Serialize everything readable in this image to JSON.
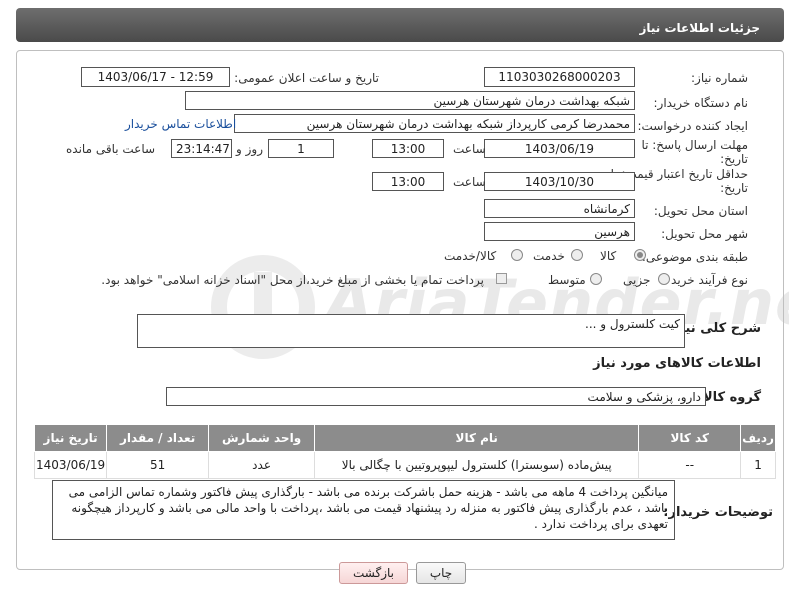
{
  "header": {
    "title": "جزئیات اطلاعات نیاز"
  },
  "form": {
    "need_number": {
      "label": "شماره نیاز:",
      "value": "1103030268000203"
    },
    "announce": {
      "label": "تاریخ و ساعت اعلان عمومی:",
      "value": "1403/06/17 - 12:59"
    },
    "buyer_org": {
      "label": "نام دستگاه خریدار:",
      "value": "شبکه بهداشت درمان شهرستان هرسین"
    },
    "creator": {
      "label": "ایجاد کننده درخواست:",
      "value": "محمدرضا کرمی کارپرداز شبکه بهداشت درمان شهرستان هرسین",
      "contact_link": "اطلاعات تماس خریدار"
    },
    "reply_deadline": {
      "label_line1": "مهلت ارسال پاسخ: تا",
      "label_line2": "تاریخ:",
      "date": "1403/06/19",
      "time_label": "ساعت",
      "time": "13:00",
      "days": "1",
      "days_label": "روز و",
      "remaining": "23:14:47",
      "remaining_label": "ساعت باقی مانده"
    },
    "price_validity": {
      "label_line1": "حداقل تاریخ اعتبار قیمت: تا",
      "label_line2": "تاریخ:",
      "date": "1403/10/30",
      "time_label": "ساعت",
      "time": "13:00"
    },
    "province": {
      "label": "استان محل تحویل:",
      "value": "کرمانشاه"
    },
    "city": {
      "label": "شهر محل تحویل:",
      "value": "هرسین"
    },
    "category": {
      "label": "طبقه بندی موضوعی:",
      "options": [
        "کالا",
        "خدمت",
        "کالا/خدمت"
      ],
      "selected": "کالا"
    },
    "process": {
      "label": "نوع فرآیند خرید :",
      "options": [
        "جزیی",
        "متوسط"
      ],
      "note": "پرداخت تمام یا بخشی از مبلغ خرید،از محل \"اسناد خزانه اسلامی\" خواهد بود."
    },
    "description": {
      "label": "شرح کلی نیاز:",
      "value": "کیت کلسترول و ..."
    }
  },
  "goods": {
    "section_title": "اطلاعات کالاهای مورد نیاز",
    "group_label": "گروه کالا:",
    "group_value": "دارو، پزشکی و سلامت",
    "columns": [
      "ردیف",
      "کد کالا",
      "نام کالا",
      "واحد شمارش",
      "تعداد / مقدار",
      "تاریخ نیاز"
    ],
    "rows": [
      [
        "1",
        "--",
        "پیش‌ماده (سوبسترا) کلسترول لیپوپروتیین با چگالی بالا",
        "عدد",
        "51",
        "1403/06/19"
      ]
    ]
  },
  "buyer_notes": {
    "label": "توضیحات خریدار:",
    "text": "میانگین پرداخت 4 ماهه می باشد - هزینه حمل باشرکت برنده می باشد - بارگذاری پیش فاکتور وشماره تماس الزامی می باشد ، عدم بارگذاری پیش فاکتور به منزله رد پیشنهاد قیمت می باشد ،پرداخت با واحد مالی می باشد و کارپرداز هیچگونه تعهدی برای پرداخت ندارد ."
  },
  "buttons": {
    "print": "چاپ",
    "back": "بازگشت"
  },
  "watermark": "AriaTender.neT"
}
